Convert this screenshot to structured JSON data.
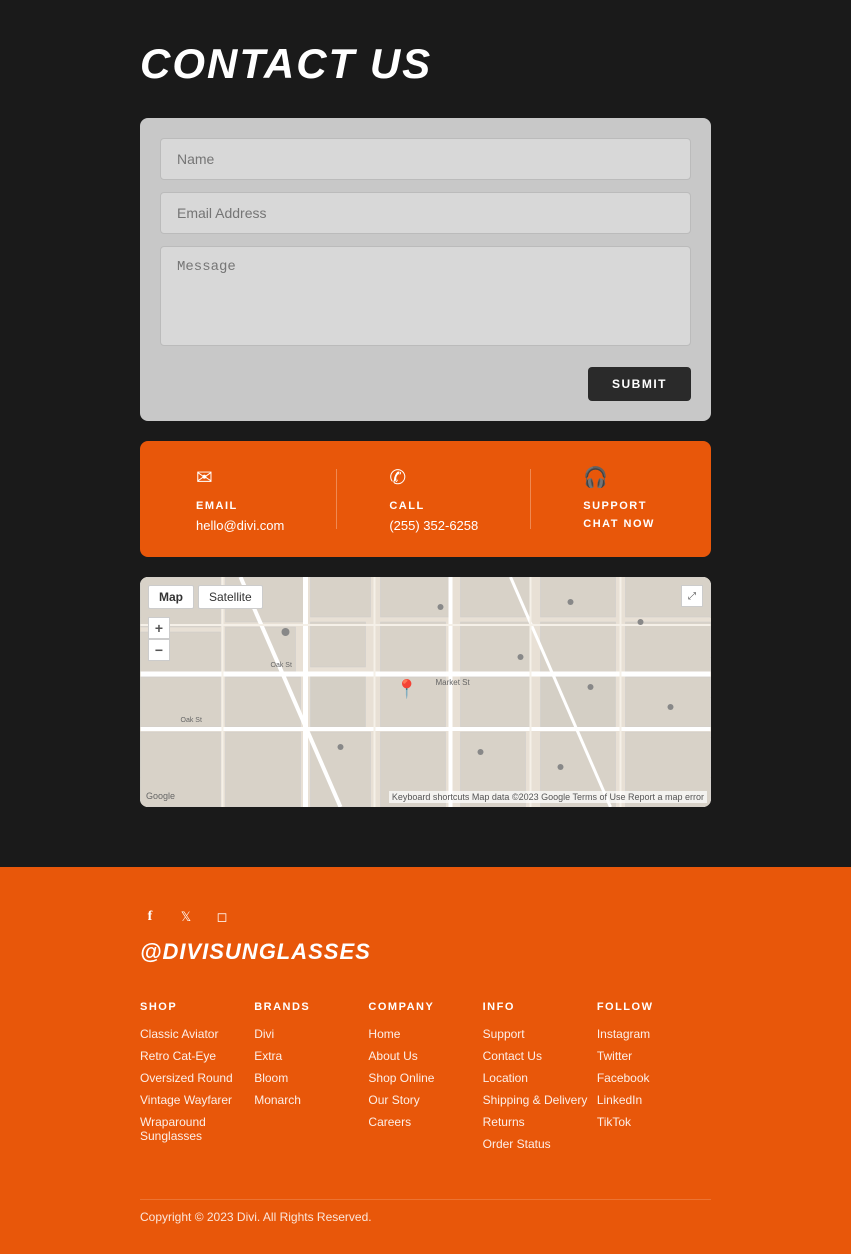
{
  "page": {
    "title": "CONTACT US"
  },
  "form": {
    "name_placeholder": "Name",
    "email_placeholder": "Email Address",
    "message_placeholder": "Message",
    "submit_label": "SUBMIT"
  },
  "contact_info": {
    "email": {
      "label": "EMAIL",
      "value": "hello@divi.com",
      "icon": "✉"
    },
    "call": {
      "label": "CALL",
      "value": "(255) 352-6258",
      "icon": "✆"
    },
    "support": {
      "label": "SUPPORT",
      "action": "CHAT NOW",
      "icon": "🎧"
    }
  },
  "map": {
    "tab_map": "Map",
    "tab_satellite": "Satellite",
    "credits": "Keyboard shortcuts  Map data ©2023 Google  Terms of Use  Report a map error"
  },
  "footer": {
    "handle": "@DIVISUNGLASSES",
    "social": [
      {
        "name": "facebook",
        "icon": "f"
      },
      {
        "name": "twitter",
        "icon": "t"
      },
      {
        "name": "instagram",
        "icon": "ig"
      }
    ],
    "columns": [
      {
        "title": "SHOP",
        "links": [
          "Classic Aviator",
          "Retro Cat-Eye",
          "Oversized Round",
          "Vintage Wayfarer",
          "Wraparound Sunglasses"
        ]
      },
      {
        "title": "BRANDS",
        "links": [
          "Divi",
          "Extra",
          "Bloom",
          "Monarch"
        ]
      },
      {
        "title": "COMPANY",
        "links": [
          "Home",
          "About Us",
          "Shop Online",
          "Our Story",
          "Careers"
        ]
      },
      {
        "title": "INFO",
        "links": [
          "Support",
          "Contact Us",
          "Location",
          "Shipping & Delivery",
          "Returns",
          "Order Status"
        ]
      },
      {
        "title": "FOLLOW",
        "links": [
          "Instagram",
          "Twitter",
          "Facebook",
          "LinkedIn",
          "TikTok"
        ]
      }
    ],
    "copyright": "Copyright © 2023 Divi. All Rights Reserved."
  }
}
